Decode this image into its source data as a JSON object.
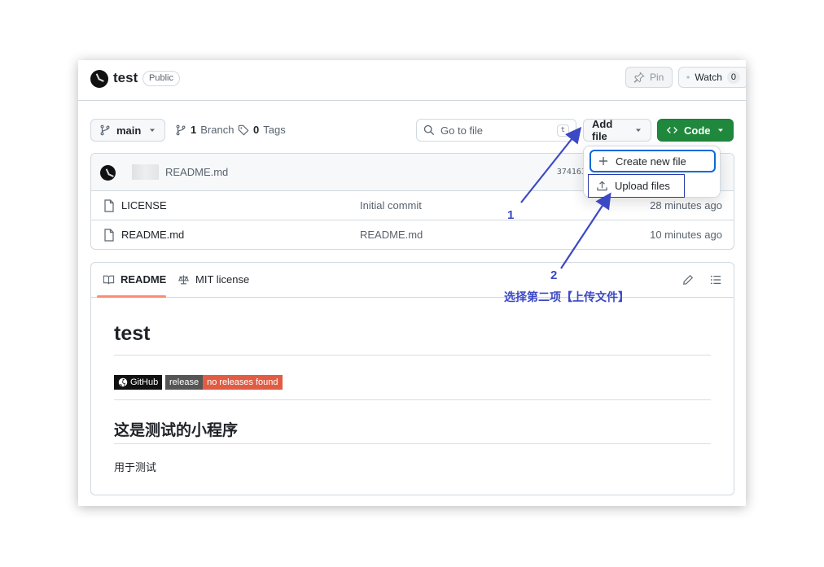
{
  "repo": {
    "name": "test",
    "visibility": "Public"
  },
  "header": {
    "pin_label": "Pin",
    "watch_label": "Watch",
    "watch_count": "0"
  },
  "toolbar": {
    "branch": "main",
    "branches_count": "1",
    "branches_label": "Branch",
    "tags_count": "0",
    "tags_label": "Tags",
    "search_placeholder": "Go to file",
    "search_shortcut": "t",
    "add_file_label": "Add file",
    "code_label": "Code"
  },
  "dropdown": {
    "items": [
      {
        "label": "Create new file",
        "icon": "plus-icon"
      },
      {
        "label": "Upload files",
        "icon": "upload-icon"
      }
    ]
  },
  "latest_commit": {
    "message": "README.md",
    "hash": "3741636"
  },
  "files": [
    {
      "name": "LICENSE",
      "message": "Initial commit",
      "date": "28 minutes ago"
    },
    {
      "name": "README.md",
      "message": "README.md",
      "date": "10 minutes ago"
    }
  ],
  "readme": {
    "tabs": [
      "README",
      "MIT license"
    ],
    "title": "test",
    "shield_github": "GitHub",
    "shield_release_label": "release",
    "shield_release_value": "no releases found",
    "heading": "这是测试的小程序",
    "paragraph": "用于测试"
  },
  "annotations": {
    "step1": "1",
    "step2": "2",
    "step2_text": "选择第二项【上传文件】"
  },
  "colors": {
    "accent": "#1f883d",
    "link": "#0969da",
    "annotation": "#3c49c4",
    "release_badge": "#e05d44"
  }
}
